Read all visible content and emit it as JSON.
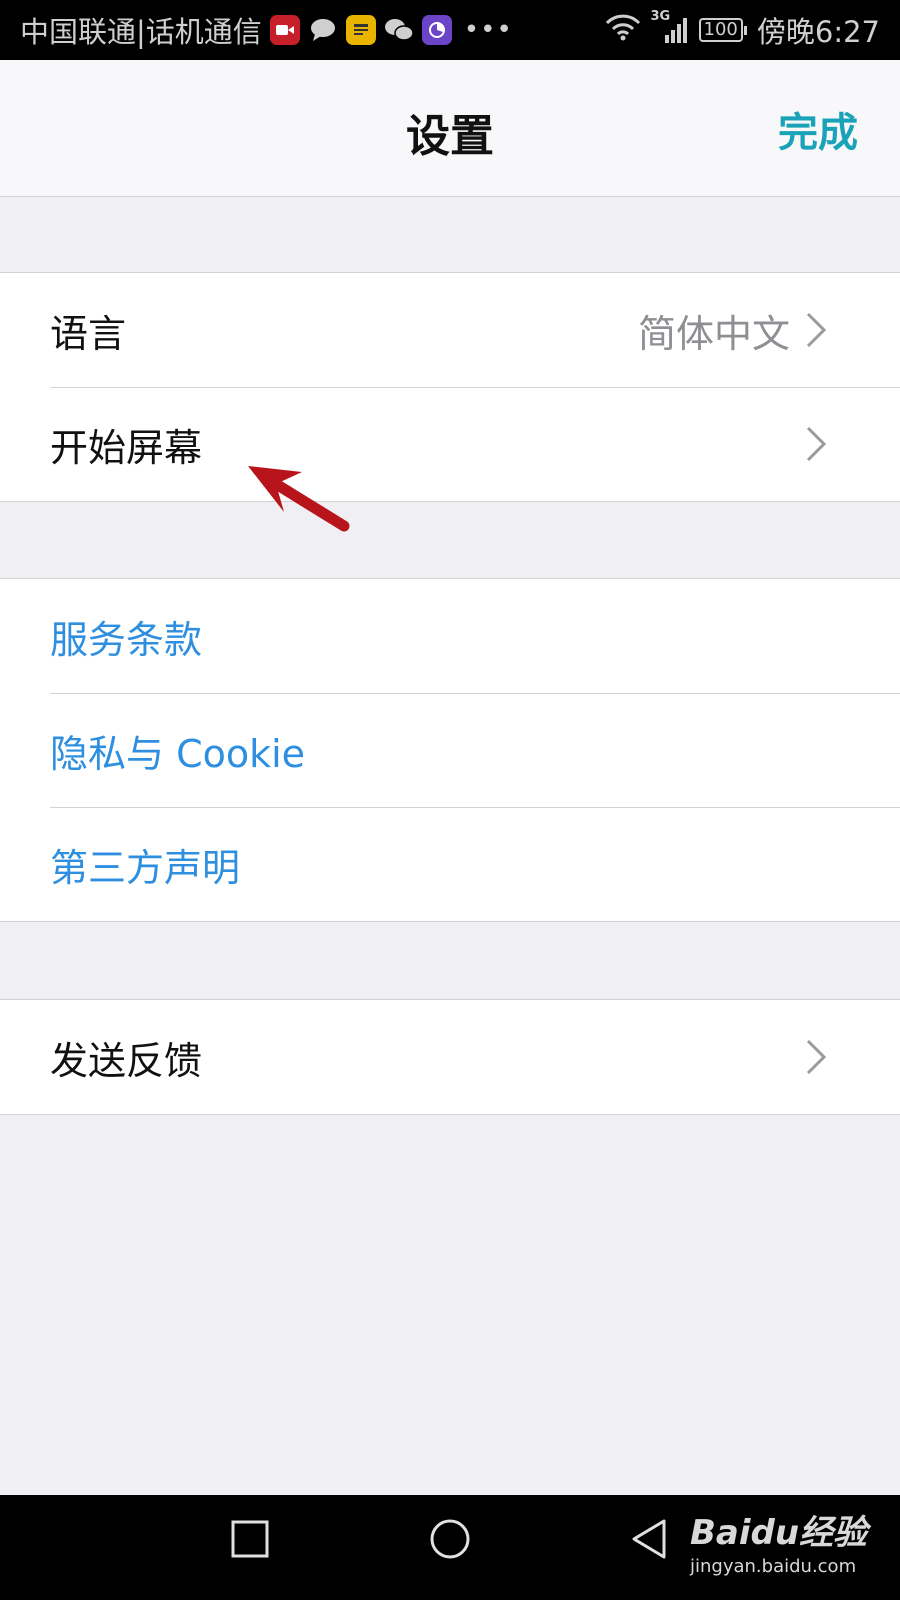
{
  "status_bar": {
    "carrier": "中国联通|话机通信",
    "network": "3G",
    "battery": "100",
    "time": "傍晚6:27"
  },
  "nav": {
    "title": "设置",
    "done_label": "完成"
  },
  "settings": {
    "language_label": "语言",
    "language_value": "简体中文",
    "start_screen_label": "开始屏幕",
    "terms_label": "服务条款",
    "privacy_label": "隐私与 Cookie",
    "third_party_label": "第三方声明",
    "feedback_label": "发送反馈"
  },
  "watermark": {
    "brand": "Baidu经验",
    "domain": "jingyan.baidu.com"
  },
  "colors": {
    "accent_teal": "#1aa3b8",
    "link_blue": "#2e8fe0",
    "annotation_red": "#b8141b",
    "background": "#efeff4"
  }
}
